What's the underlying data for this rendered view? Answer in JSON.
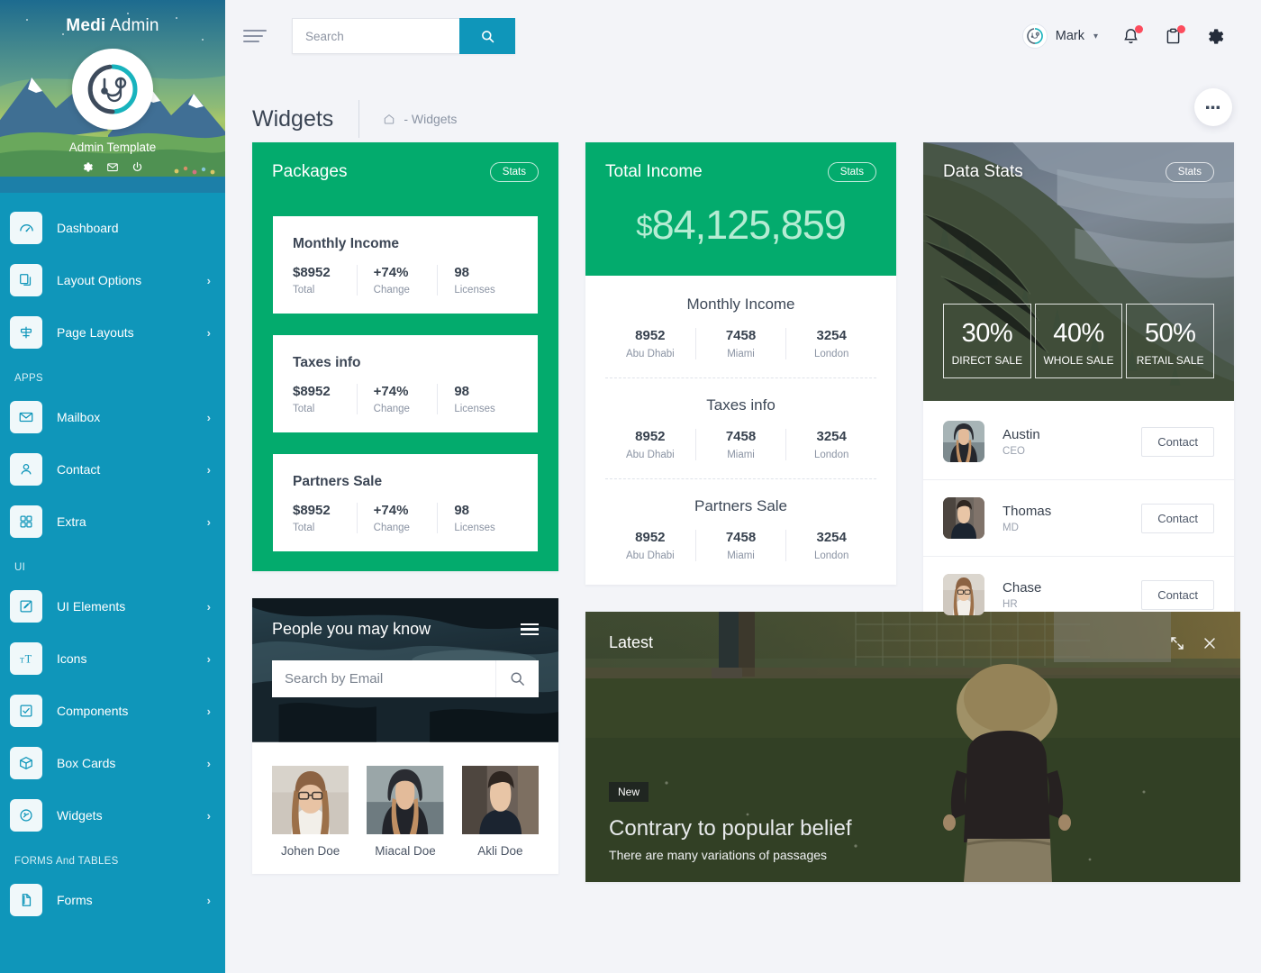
{
  "brand": {
    "bold": "Medi",
    "light": "Admin",
    "subtitle": "Admin Template"
  },
  "sidebar": {
    "items": [
      {
        "label": "Dashboard",
        "icon": "dashboard-icon",
        "arrow": ""
      },
      {
        "label": "Layout Options",
        "icon": "layers-icon",
        "arrow": "›"
      },
      {
        "label": "Page Layouts",
        "icon": "page-layout-icon",
        "arrow": "›"
      }
    ],
    "section_apps": "APPS",
    "apps": [
      {
        "label": "Mailbox",
        "icon": "envelope-icon",
        "arrow": "›"
      },
      {
        "label": "Contact",
        "icon": "user-icon",
        "arrow": "›"
      },
      {
        "label": "Extra",
        "icon": "grid-icon",
        "arrow": "›"
      }
    ],
    "section_ui": "UI",
    "ui": [
      {
        "label": "UI Elements",
        "icon": "pencil-square-icon",
        "arrow": "›"
      },
      {
        "label": "Icons",
        "icon": "text-size-icon",
        "arrow": "›"
      },
      {
        "label": "Components",
        "icon": "check-square-icon",
        "arrow": "›"
      },
      {
        "label": "Box Cards",
        "icon": "box-icon",
        "arrow": "›"
      },
      {
        "label": "Widgets",
        "icon": "widgets-icon",
        "arrow": "›"
      }
    ],
    "section_forms": "FORMS And TABLES",
    "forms": [
      {
        "label": "Forms",
        "icon": "document-icon",
        "arrow": "›"
      }
    ]
  },
  "topbar": {
    "search_placeholder": "Search",
    "search_value": "",
    "user_name": "Mark"
  },
  "page": {
    "title": "Widgets",
    "breadcrumb": "- Widgets",
    "fab_label": "•••"
  },
  "packages": {
    "title": "Packages",
    "stats_label": "Stats",
    "boxes": [
      {
        "title": "Monthly Income",
        "total": "$8952",
        "total_cap": "Total",
        "change": "+74%",
        "change_cap": "Change",
        "licenses": "98",
        "licenses_cap": "Licenses"
      },
      {
        "title": "Taxes info",
        "total": "$8952",
        "total_cap": "Total",
        "change": "+74%",
        "change_cap": "Change",
        "licenses": "98",
        "licenses_cap": "Licenses"
      },
      {
        "title": "Partners Sale",
        "total": "$8952",
        "total_cap": "Total",
        "change": "+74%",
        "change_cap": "Change",
        "licenses": "98",
        "licenses_cap": "Licenses"
      }
    ]
  },
  "total_income": {
    "title": "Total Income",
    "stats_label": "Stats",
    "currency": "$",
    "amount": "84,125,859",
    "sections": [
      {
        "title": "Monthly Income",
        "cells": [
          {
            "num": "8952",
            "city": "Abu Dhabi"
          },
          {
            "num": "7458",
            "city": "Miami"
          },
          {
            "num": "3254",
            "city": "London"
          }
        ]
      },
      {
        "title": "Taxes info",
        "cells": [
          {
            "num": "8952",
            "city": "Abu Dhabi"
          },
          {
            "num": "7458",
            "city": "Miami"
          },
          {
            "num": "3254",
            "city": "London"
          }
        ]
      },
      {
        "title": "Partners Sale",
        "cells": [
          {
            "num": "8952",
            "city": "Abu Dhabi"
          },
          {
            "num": "7458",
            "city": "Miami"
          },
          {
            "num": "3254",
            "city": "London"
          }
        ]
      }
    ]
  },
  "data_stats": {
    "title": "Data Stats",
    "stats_label": "Stats",
    "boxes": [
      {
        "pct": "30%",
        "label": "DIRECT SALE"
      },
      {
        "pct": "40%",
        "label": "WHOLE SALE"
      },
      {
        "pct": "50%",
        "label": "RETAIL SALE"
      }
    ],
    "contacts": [
      {
        "name": "Austin",
        "role": "CEO",
        "button": "Contact"
      },
      {
        "name": "Thomas",
        "role": "MD",
        "button": "Contact"
      },
      {
        "name": "Chase",
        "role": "HR",
        "button": "Contact"
      }
    ]
  },
  "people": {
    "title": "People you may know",
    "search_placeholder": "Search by Email",
    "search_value": "",
    "persons": [
      {
        "name": "Johen Doe"
      },
      {
        "name": "Miacal Doe"
      },
      {
        "name": "Akli Doe"
      }
    ]
  },
  "latest": {
    "title": "Latest",
    "badge": "New",
    "headline": "Contrary to popular belief",
    "subtext": "There are many variations of passages"
  },
  "colors": {
    "sidebar": "#0f96ba",
    "accent_green": "#03ab6d",
    "amount_green": "#b5ecd3",
    "badge_red": "#fc4c5d",
    "page_bg": "#f3f4f8"
  }
}
